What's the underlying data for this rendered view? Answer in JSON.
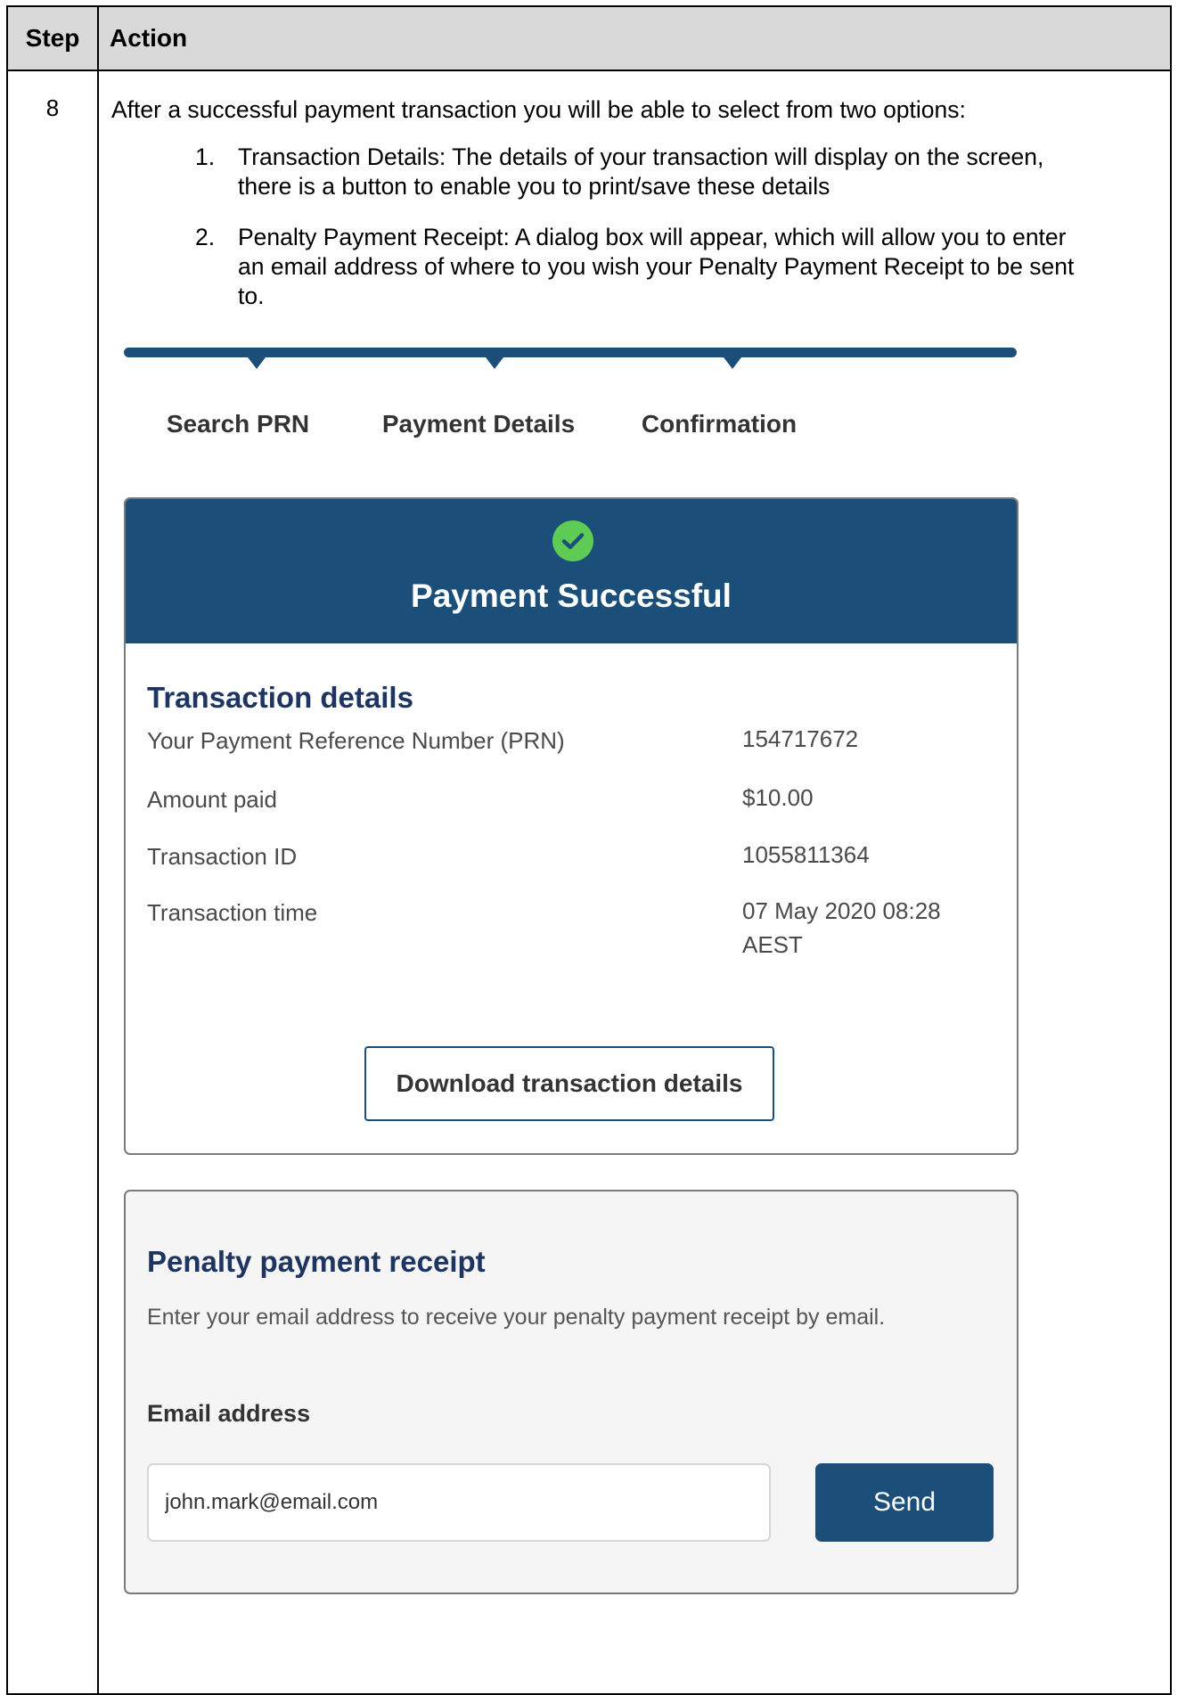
{
  "table": {
    "headers": {
      "step": "Step",
      "action": "Action"
    },
    "row": {
      "step": "8",
      "intro": "After a successful payment transaction you will be able to select from two options:",
      "options": [
        {
          "num": "1.",
          "lines": [
            "Transaction Details: The details of your transaction will display on the screen,",
            "there is a button to enable you to print/save these details"
          ]
        },
        {
          "num": "2.",
          "lines": [
            "Penalty Payment Receipt: A dialog box will appear, which will allow you to enter",
            "an email address of where to you wish your Penalty Payment Receipt to be sent",
            "to."
          ]
        }
      ]
    }
  },
  "progress": {
    "steps": [
      "Search PRN",
      "Payment Details",
      "Confirmation"
    ],
    "bar_color": "#1b4f7a"
  },
  "success_card": {
    "icon": "check-circle-icon",
    "title": "Payment Successful",
    "header_color": "#1b4f7a",
    "section_title": "Transaction details",
    "rows": [
      {
        "label": "Your Payment Reference Number (PRN)",
        "value": "154717672"
      },
      {
        "label": "Amount paid",
        "value": "$10.00"
      },
      {
        "label": "Transaction ID",
        "value": "1055811364"
      },
      {
        "label": "Transaction time",
        "value": "07 May 2020 08:28 AEST"
      }
    ],
    "download_label": "Download transaction details"
  },
  "receipt_card": {
    "title": "Penalty payment receipt",
    "description": "Enter your email address to receive your penalty payment receipt by email.",
    "email_label": "Email address",
    "email_value": "john.mark@email.com",
    "send_label": "Send"
  }
}
